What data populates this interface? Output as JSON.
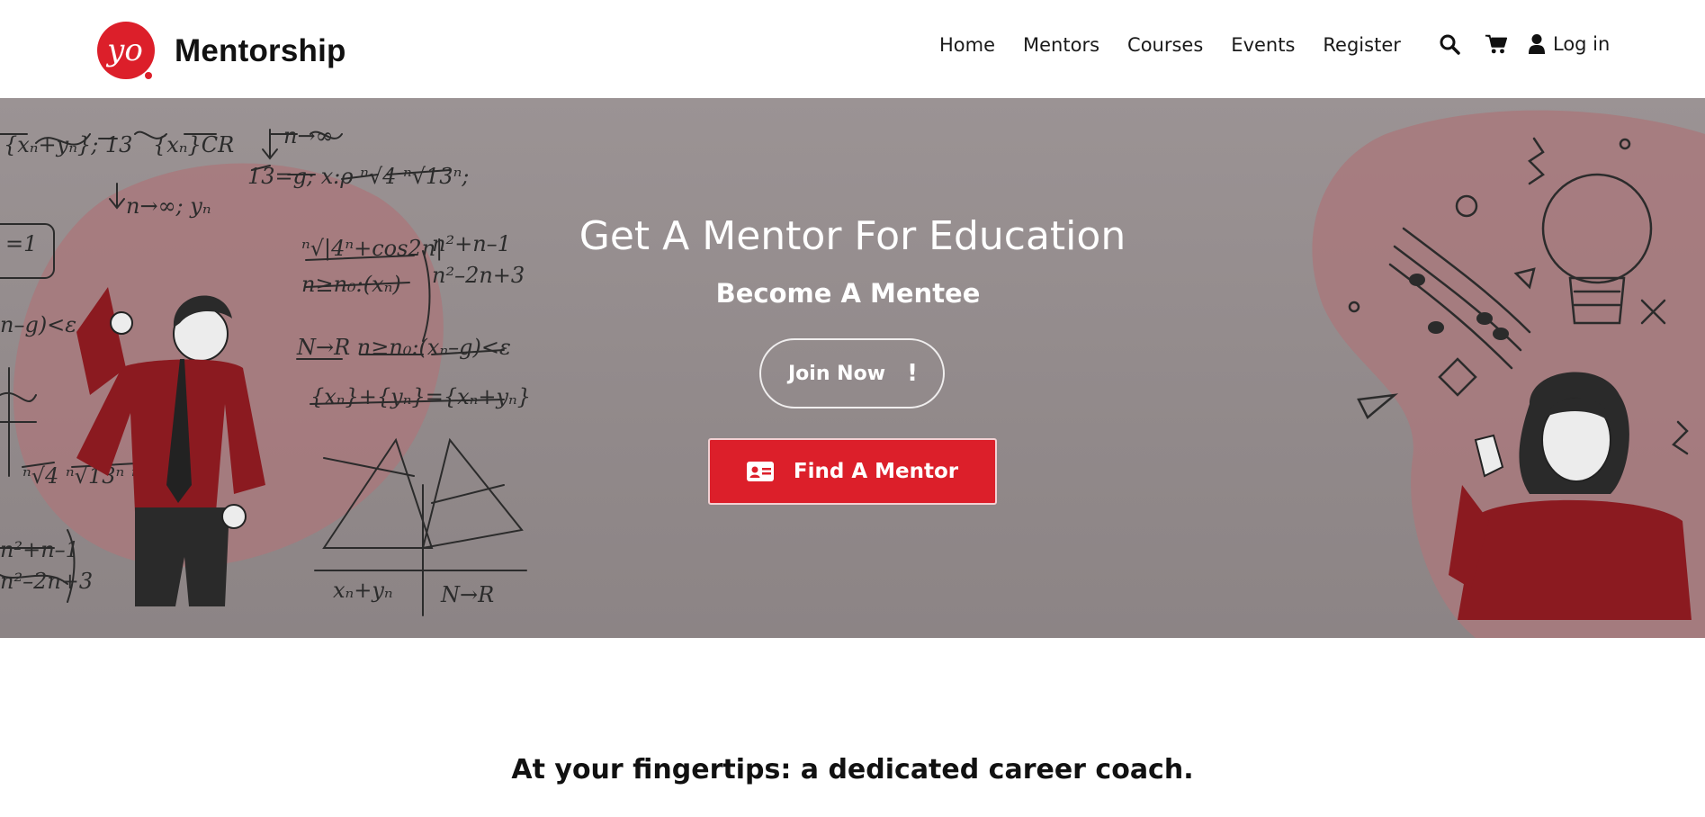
{
  "header": {
    "brand": "Mentorship",
    "logo_text": "yo",
    "nav": [
      "Home",
      "Mentors",
      "Courses",
      "Events",
      "Register"
    ],
    "icons": [
      "search-icon",
      "cart-icon",
      "user-icon"
    ],
    "login_label": "Log in"
  },
  "hero": {
    "title": "Get A Mentor For Education",
    "subtitle": "Become A Mentee",
    "join_label": "Join Now",
    "join_icon": "!",
    "find_label": "Find A Mentor",
    "find_icon": "id-card-icon"
  },
  "tagline": "At your fingertips: a dedicated career coach.",
  "colors": {
    "accent": "#dc1f2a",
    "hero_overlay": "#968e8f",
    "blob": "#a8787c"
  }
}
